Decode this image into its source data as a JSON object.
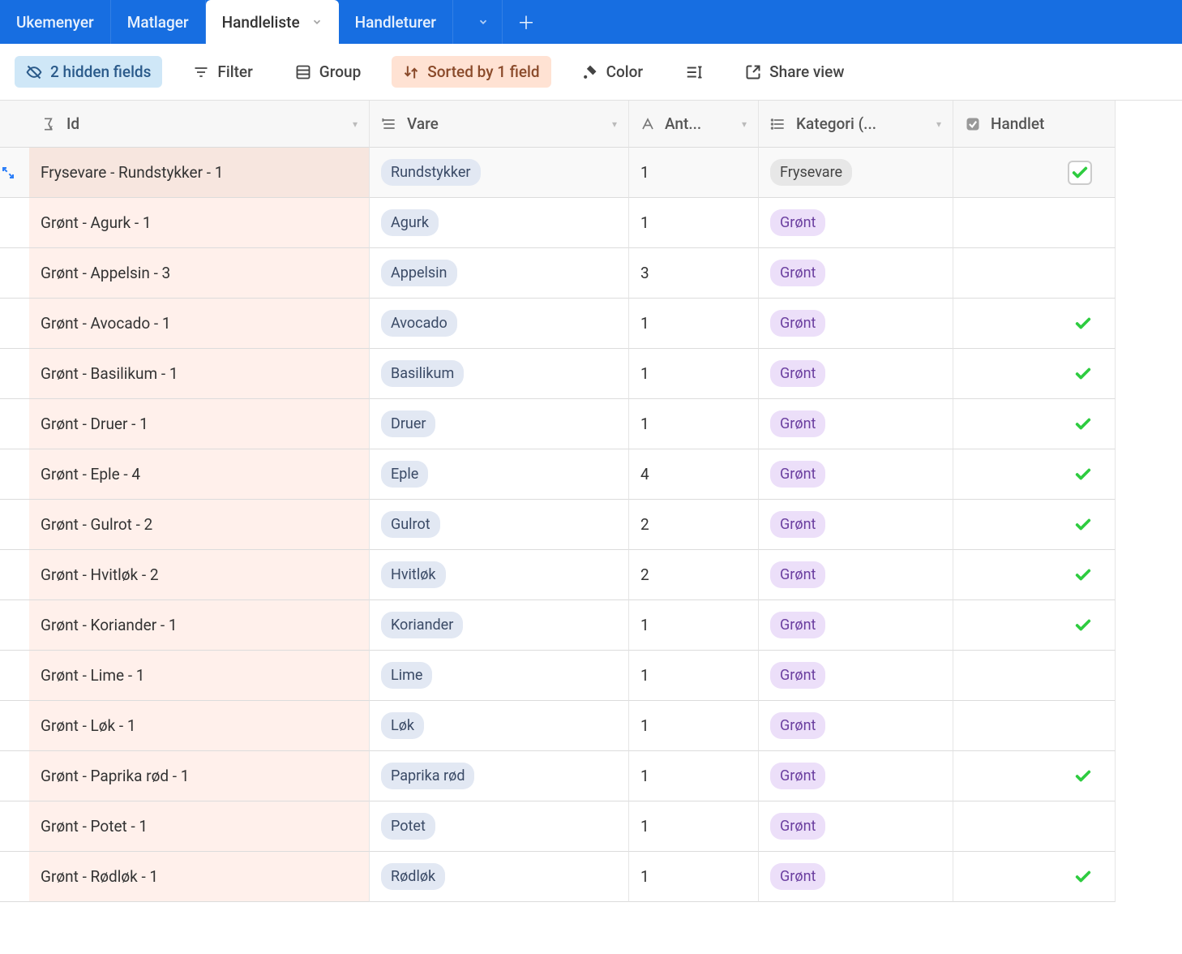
{
  "tabs": {
    "items": [
      {
        "label": "Ukemenyer",
        "active": false,
        "has_dropdown": false
      },
      {
        "label": "Matlager",
        "active": false,
        "has_dropdown": false
      },
      {
        "label": "Handleliste",
        "active": true,
        "has_dropdown": true
      },
      {
        "label": "Handleturer",
        "active": false,
        "has_dropdown": false
      }
    ]
  },
  "toolbar": {
    "hidden_fields": "2 hidden fields",
    "filter": "Filter",
    "group": "Group",
    "sorted": "Sorted by 1 field",
    "color": "Color",
    "share": "Share view"
  },
  "columns": {
    "id": "Id",
    "vare": "Vare",
    "antall": "Ant...",
    "kategori": "Kategori (...",
    "handlet": "Handlet"
  },
  "rows": [
    {
      "id": "Frysevare - Rundstykker - 1",
      "vare": "Rundstykker",
      "antall": "1",
      "kategori": "Frysevare",
      "kat_class": "cat-fryse",
      "handlet": true,
      "handlet_boxed": true,
      "hovered": true
    },
    {
      "id": "Grønt - Agurk - 1",
      "vare": "Agurk",
      "antall": "1",
      "kategori": "Grønt",
      "kat_class": "cat-gront",
      "handlet": false
    },
    {
      "id": "Grønt - Appelsin - 3",
      "vare": "Appelsin",
      "antall": "3",
      "kategori": "Grønt",
      "kat_class": "cat-gront",
      "handlet": false
    },
    {
      "id": "Grønt - Avocado - 1",
      "vare": "Avocado",
      "antall": "1",
      "kategori": "Grønt",
      "kat_class": "cat-gront",
      "handlet": true
    },
    {
      "id": "Grønt - Basilikum - 1",
      "vare": "Basilikum",
      "antall": "1",
      "kategori": "Grønt",
      "kat_class": "cat-gront",
      "handlet": true
    },
    {
      "id": "Grønt - Druer - 1",
      "vare": "Druer",
      "antall": "1",
      "kategori": "Grønt",
      "kat_class": "cat-gront",
      "handlet": true
    },
    {
      "id": "Grønt - Eple - 4",
      "vare": "Eple",
      "antall": "4",
      "kategori": "Grønt",
      "kat_class": "cat-gront",
      "handlet": true
    },
    {
      "id": "Grønt - Gulrot - 2",
      "vare": "Gulrot",
      "antall": "2",
      "kategori": "Grønt",
      "kat_class": "cat-gront",
      "handlet": true
    },
    {
      "id": "Grønt - Hvitløk - 2",
      "vare": "Hvitløk",
      "antall": "2",
      "kategori": "Grønt",
      "kat_class": "cat-gront",
      "handlet": true
    },
    {
      "id": "Grønt - Koriander - 1",
      "vare": "Koriander",
      "antall": "1",
      "kategori": "Grønt",
      "kat_class": "cat-gront",
      "handlet": true
    },
    {
      "id": "Grønt - Lime - 1",
      "vare": "Lime",
      "antall": "1",
      "kategori": "Grønt",
      "kat_class": "cat-gront",
      "handlet": false
    },
    {
      "id": "Grønt - Løk - 1",
      "vare": "Løk",
      "antall": "1",
      "kategori": "Grønt",
      "kat_class": "cat-gront",
      "handlet": false
    },
    {
      "id": "Grønt - Paprika rød - 1",
      "vare": "Paprika rød",
      "antall": "1",
      "kategori": "Grønt",
      "kat_class": "cat-gront",
      "handlet": true
    },
    {
      "id": "Grønt - Potet - 1",
      "vare": "Potet",
      "antall": "1",
      "kategori": "Grønt",
      "kat_class": "cat-gront",
      "handlet": false
    },
    {
      "id": "Grønt - Rødløk - 1",
      "vare": "Rødløk",
      "antall": "1",
      "kategori": "Grønt",
      "kat_class": "cat-gront",
      "handlet": true
    }
  ]
}
